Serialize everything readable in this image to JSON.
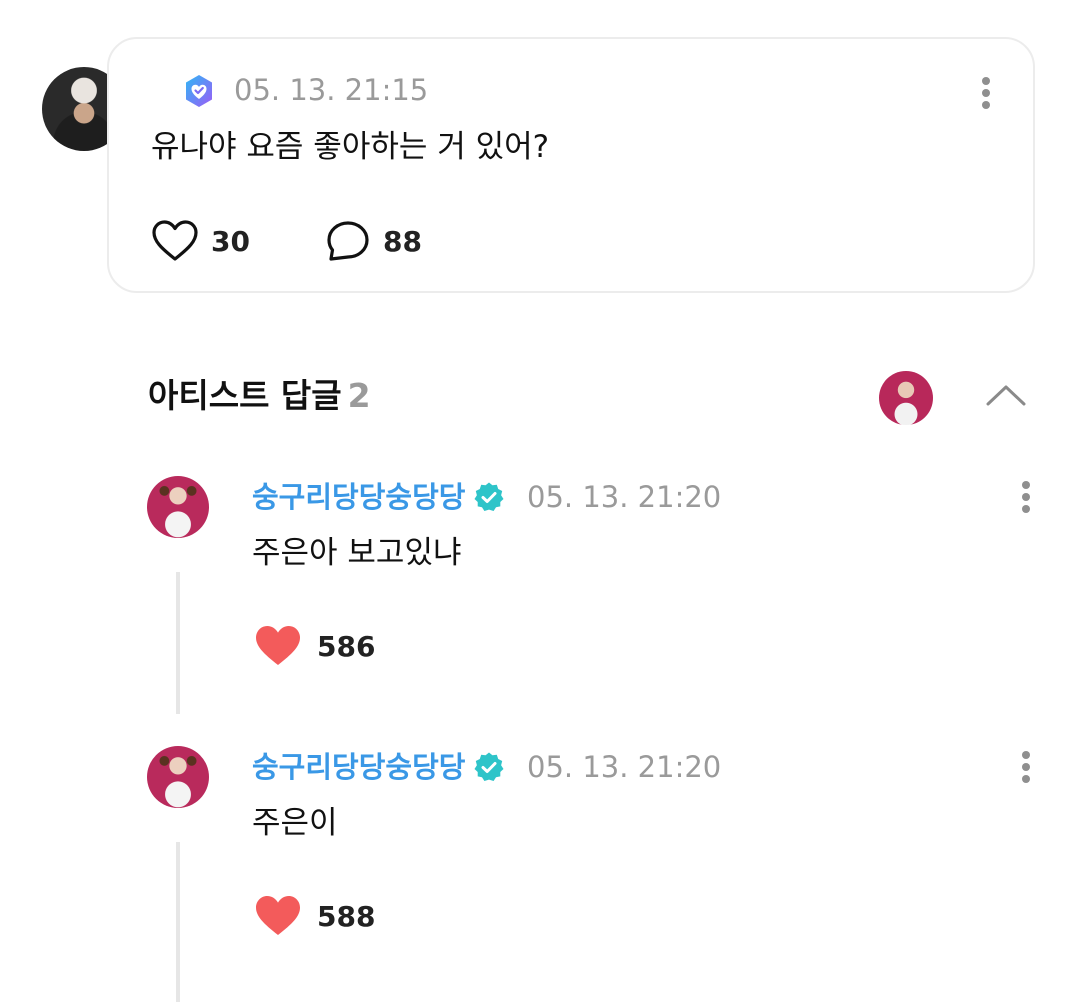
{
  "post": {
    "timestamp": "05. 13. 21:15",
    "text": "유나야 요즘 좋아하는 거 있어?",
    "likes": "30",
    "comments": "88"
  },
  "artist_replies": {
    "title": "아티스트 답글",
    "count": "2",
    "replies": [
      {
        "username": "숭구리당당숭당당",
        "timestamp": "05. 13. 21:20",
        "text": "주은아 보고있냐",
        "likes": "586"
      },
      {
        "username": "숭구리당당숭당당",
        "timestamp": "05. 13. 21:20",
        "text": "주은이",
        "likes": "588"
      }
    ]
  },
  "icons": {
    "post_badge": "heart-check-badge-icon",
    "like": "heart-outline-icon",
    "comment": "comment-bubble-icon",
    "more": "more-vertical-icon",
    "collapse": "chevron-up-icon",
    "verified": "verified-badge-icon",
    "liked": "heart-filled-icon"
  },
  "colors": {
    "username": "#3a98e6",
    "verified": "#2ec4c9",
    "liked_heart": "#f35b5b",
    "muted_text": "#9a9a9a"
  }
}
